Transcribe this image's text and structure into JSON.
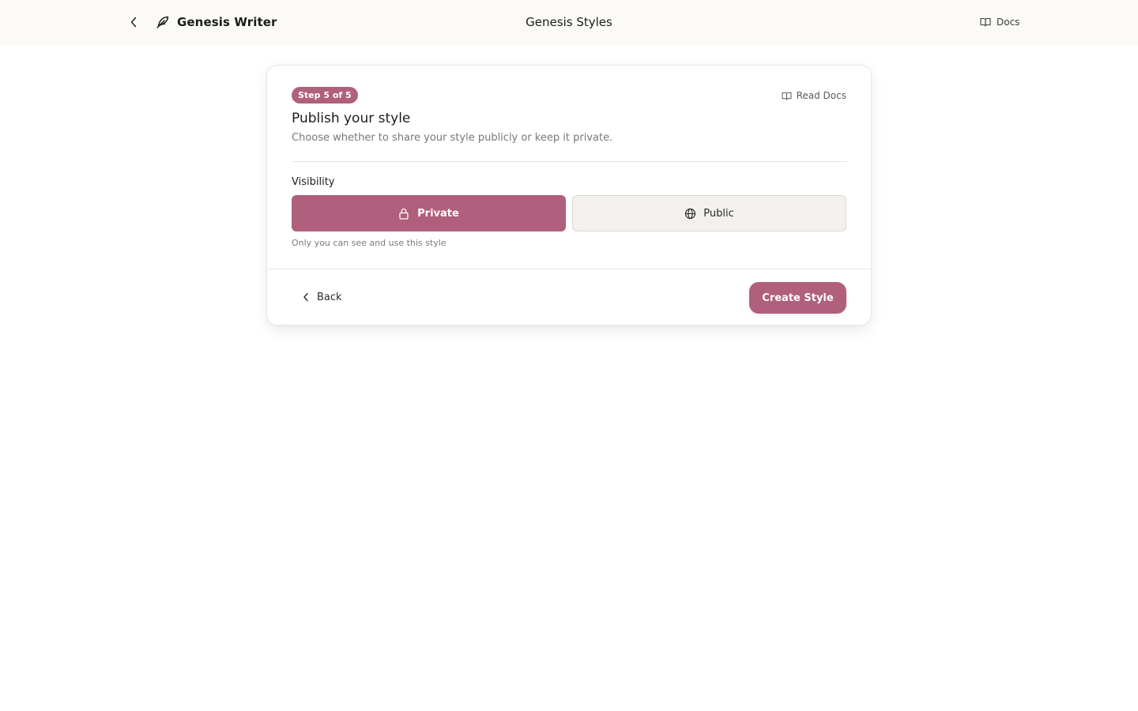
{
  "header": {
    "app_name": "Genesis Writer",
    "page_title": "Genesis Styles",
    "docs_label": "Docs"
  },
  "card": {
    "step_badge": "Step 5 of 5",
    "read_docs_label": "Read Docs",
    "title": "Publish your style",
    "subtitle": "Choose whether to share your style publicly or keep it private.",
    "visibility_label": "Visibility",
    "options": [
      {
        "label": "Private",
        "icon": "lock-icon",
        "selected": true
      },
      {
        "label": "Public",
        "icon": "globe-icon",
        "selected": false
      }
    ],
    "hint": "Only you can see and use this style",
    "back_label": "Back",
    "create_label": "Create Style"
  },
  "colors": {
    "accent": "#b05f7c",
    "header_bg": "#fbfaf7",
    "unselected_bg": "#f3f1ed"
  }
}
